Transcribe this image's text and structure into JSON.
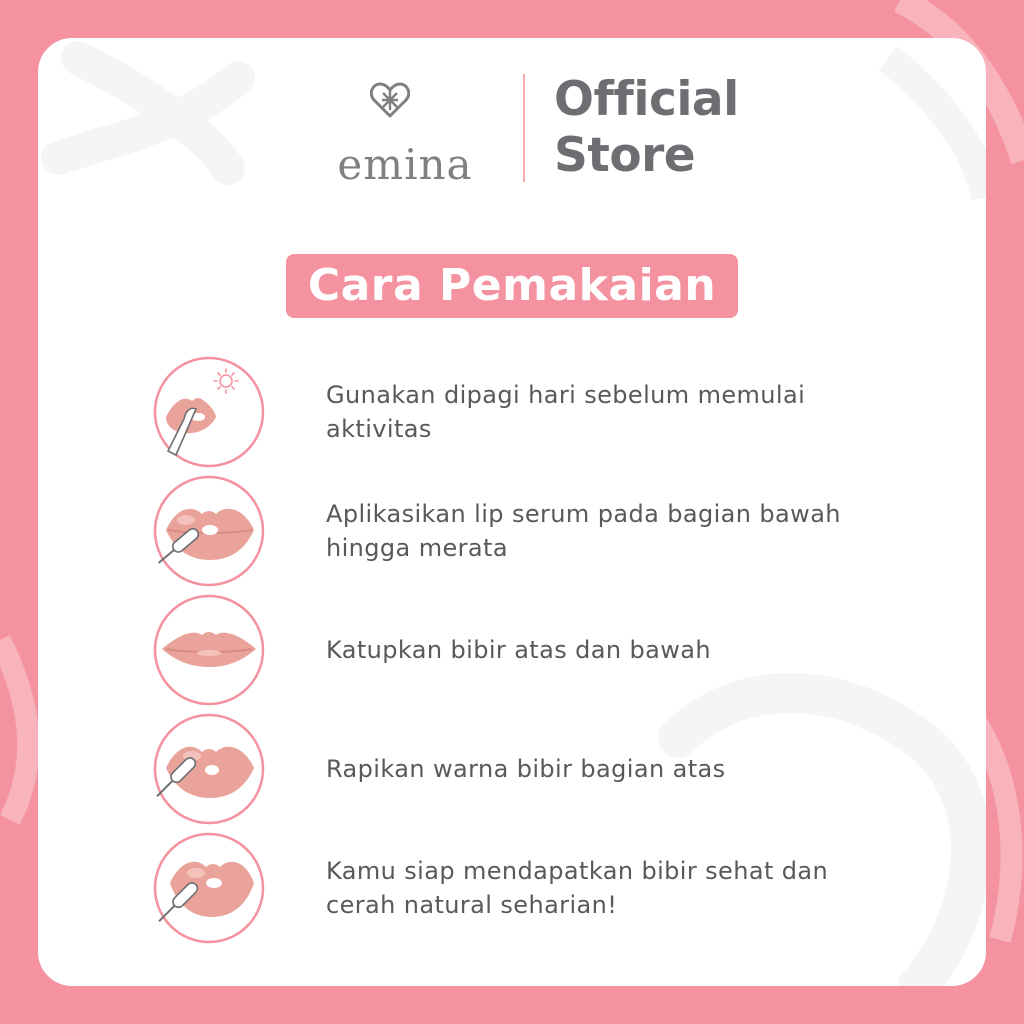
{
  "header": {
    "brand_name": "emina",
    "store_title_line1": "Official",
    "store_title_line2": "Store"
  },
  "section_title": "Cara Pemakaian",
  "steps": [
    {
      "text": "Gunakan dipagi hari sebelum memulai aktivitas",
      "icon": "lips-sun-icon"
    },
    {
      "text": "Aplikasikan lip serum pada bagian bawah hingga merata",
      "icon": "lips-applicator-icon"
    },
    {
      "text": "Katupkan bibir atas dan bawah",
      "icon": "closed-lips-icon"
    },
    {
      "text": "Rapikan warna bibir bagian atas",
      "icon": "lips-applicator-icon"
    },
    {
      "text": "Kamu siap mendapatkan bibir sehat dan cerah natural seharian!",
      "icon": "lips-applicator-icon"
    }
  ],
  "colors": {
    "frame_pink": "#F4929F",
    "accent_pink": "#F6A9B3",
    "lip_pink": "#EAA39B",
    "text_gray": "#58595B",
    "title_gray": "#6D6E71"
  }
}
